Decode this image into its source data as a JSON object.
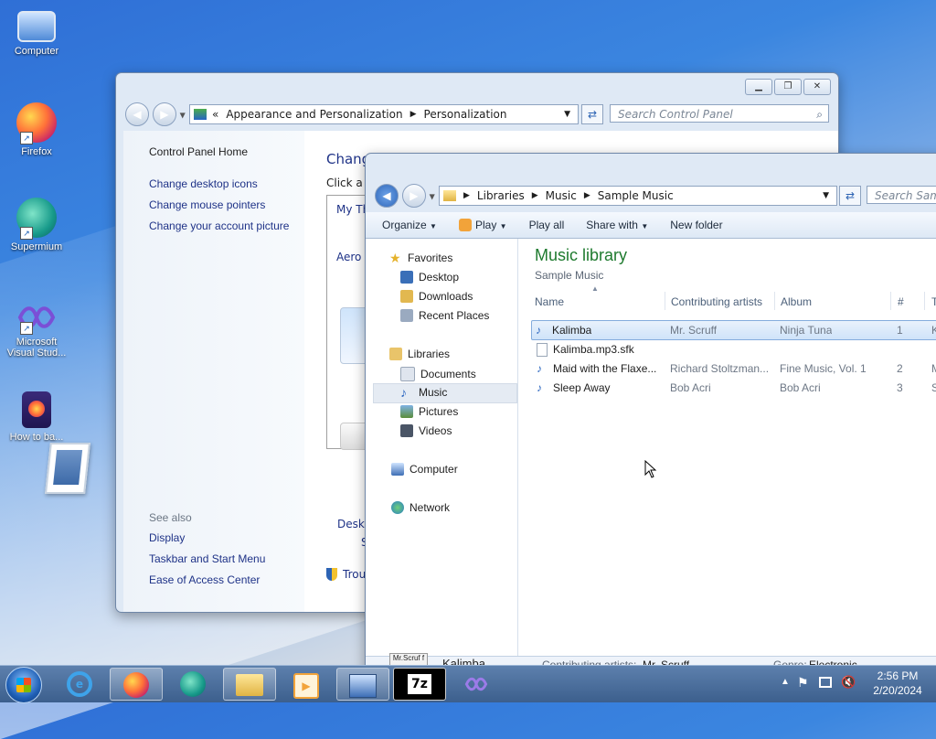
{
  "desktop": {
    "icons": [
      {
        "label": "Computer"
      },
      {
        "label": "Firefox"
      },
      {
        "label": "Supermium"
      },
      {
        "label": "Microsoft Visual Stud..."
      },
      {
        "label": "How to ba..."
      }
    ]
  },
  "control_panel": {
    "address": {
      "prefix": "«",
      "crumbs": [
        "Appearance and Personalization",
        "Personalization"
      ]
    },
    "search_placeholder": "Search Control Panel",
    "left_links": [
      "Control Panel Home",
      "Change desktop icons",
      "Change mouse pointers",
      "Change your account picture"
    ],
    "see_also_label": "See also",
    "see_also_links": [
      "Display",
      "Taskbar and Start Menu",
      "Ease of Access Center"
    ],
    "main_title_partial": "Chang",
    "main_subtitle_partial": "Click a t",
    "mythemes_partial": "My Th",
    "aero_partial": "Aero T",
    "desktop_partial": "Deskt",
    "s_partial": "S",
    "trouble_partial": "Trou"
  },
  "explorer": {
    "address": {
      "crumbs": [
        "Libraries",
        "Music",
        "Sample Music"
      ]
    },
    "search_placeholder": "Search Samp",
    "toolbar": {
      "organize": "Organize",
      "play": "Play",
      "play_all": "Play all",
      "share_with": "Share with",
      "new_folder": "New folder"
    },
    "nav": {
      "favorites": "Favorites",
      "desktop": "Desktop",
      "downloads": "Downloads",
      "recent": "Recent Places",
      "libraries": "Libraries",
      "documents": "Documents",
      "music": "Music",
      "pictures": "Pictures",
      "videos": "Videos",
      "computer": "Computer",
      "network": "Network"
    },
    "library_title": "Music library",
    "library_subtitle": "Sample Music",
    "columns": {
      "name": "Name",
      "artists": "Contributing artists",
      "album": "Album",
      "num": "#",
      "extra": "T"
    },
    "files": [
      {
        "name": "Kalimba",
        "artist": "Mr. Scruff",
        "album": "Ninja Tuna",
        "num": "1",
        "extra": "K"
      },
      {
        "name": "Kalimba.mp3.sfk",
        "artist": "",
        "album": "",
        "num": "",
        "extra": ""
      },
      {
        "name": "Maid with the Flaxe...",
        "artist": "Richard Stoltzman...",
        "album": "Fine Music, Vol. 1",
        "num": "2",
        "extra": "M"
      },
      {
        "name": "Sleep Away",
        "artist": "Bob Acri",
        "album": "Bob Acri",
        "num": "3",
        "extra": "S"
      }
    ],
    "details": {
      "art_text": "Mr.Scruf f",
      "name": "Kalimba",
      "artists_label": "Contributing artists:",
      "artists_value": "Mr. Scruff",
      "genre_label": "Genre:",
      "genre_value": "Electronic"
    }
  },
  "taskbar": {
    "time": "2:56 PM",
    "date": "2/20/2024",
    "apps": [
      "start",
      "internet-explorer",
      "firefox",
      "supermium",
      "file-explorer",
      "media-player",
      "control-panel",
      "7zip",
      "visual-studio"
    ],
    "zip_label": "7z"
  }
}
